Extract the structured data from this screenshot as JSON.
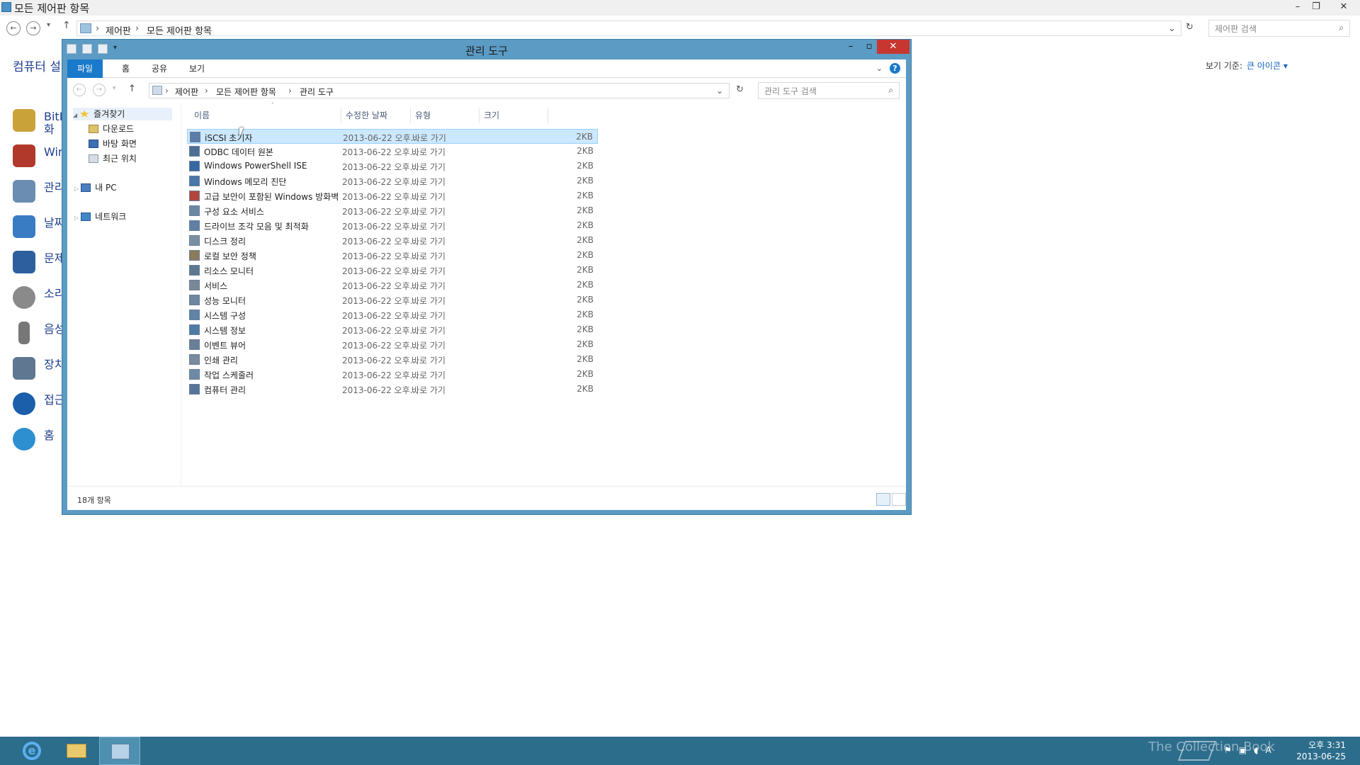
{
  "background_window": {
    "title": "모든 제어판 항목",
    "breadcrumb": [
      "제어판",
      "모든 제어판 항목"
    ],
    "search_placeholder": "제어판 검색",
    "heading": "컴퓨터 설",
    "view_by_label": "보기 기준:",
    "view_by_value": "큰 아이콘 ▾",
    "items": [
      {
        "label": "BitL\n화",
        "color": "#c9a33a"
      },
      {
        "label": "Win",
        "color": "#b0392b"
      },
      {
        "label": "관리",
        "color": "#6b8db2"
      },
      {
        "label": "날짜",
        "color": "#3a7cc4"
      },
      {
        "label": "문제",
        "color": "#2d5f9e"
      },
      {
        "label": "소리",
        "color": "#8a8a8a"
      },
      {
        "label": "음성",
        "color": "#777777"
      },
      {
        "label": "장치",
        "color": "#5f7790"
      },
      {
        "label": "접근",
        "color": "#1b5faa"
      },
      {
        "label": "홈",
        "color": "#2d8fd0"
      }
    ]
  },
  "window": {
    "title": "관리 도구",
    "ribbon_tabs": [
      {
        "label": "파일",
        "active": true
      },
      {
        "label": "홈",
        "active": false
      },
      {
        "label": "공유",
        "active": false
      },
      {
        "label": "보기",
        "active": false
      }
    ],
    "breadcrumb": [
      "제어판",
      "모든 제어판 항목",
      "관리 도구"
    ],
    "search_placeholder": "관리 도구 검색",
    "nav_tree": [
      {
        "label": "즐겨찾기",
        "level": 0,
        "selected": true
      },
      {
        "label": "다운로드",
        "level": 1
      },
      {
        "label": "바탕 화면",
        "level": 1
      },
      {
        "label": "최근 위치",
        "level": 1
      },
      {
        "label": "내 PC",
        "level": 0
      },
      {
        "label": "네트워크",
        "level": 0
      }
    ],
    "columns": [
      "이름",
      "수정한 날짜",
      "유형",
      "크기"
    ],
    "files": [
      {
        "name": "iSCSI 초기자",
        "date": "2013-06-22 오후...",
        "type": "바로 가기",
        "size": "2KB",
        "selected": true
      },
      {
        "name": "ODBC 데이터 원본",
        "date": "2013-06-22 오후...",
        "type": "바로 가기",
        "size": "2KB"
      },
      {
        "name": "Windows PowerShell ISE",
        "date": "2013-06-22 오후...",
        "type": "바로 가기",
        "size": "2KB"
      },
      {
        "name": "Windows 메모리 진단",
        "date": "2013-06-22 오후...",
        "type": "바로 가기",
        "size": "2KB"
      },
      {
        "name": "고급 보안이 포함된 Windows 방화벽",
        "date": "2013-06-22 오후...",
        "type": "바로 가기",
        "size": "2KB"
      },
      {
        "name": "구성 요소 서비스",
        "date": "2013-06-22 오후...",
        "type": "바로 가기",
        "size": "2KB"
      },
      {
        "name": "드라이브 조각 모음 및 최적화",
        "date": "2013-06-22 오후...",
        "type": "바로 가기",
        "size": "2KB"
      },
      {
        "name": "디스크 정리",
        "date": "2013-06-22 오후...",
        "type": "바로 가기",
        "size": "2KB"
      },
      {
        "name": "로컬 보안 정책",
        "date": "2013-06-22 오후...",
        "type": "바로 가기",
        "size": "2KB"
      },
      {
        "name": "리소스 모니터",
        "date": "2013-06-22 오후...",
        "type": "바로 가기",
        "size": "2KB"
      },
      {
        "name": "서비스",
        "date": "2013-06-22 오후...",
        "type": "바로 가기",
        "size": "2KB"
      },
      {
        "name": "성능 모니터",
        "date": "2013-06-22 오후...",
        "type": "바로 가기",
        "size": "2KB"
      },
      {
        "name": "시스템 구성",
        "date": "2013-06-22 오후...",
        "type": "바로 가기",
        "size": "2KB"
      },
      {
        "name": "시스템 정보",
        "date": "2013-06-22 오후...",
        "type": "바로 가기",
        "size": "2KB"
      },
      {
        "name": "이벤트 뷰어",
        "date": "2013-06-22 오후...",
        "type": "바로 가기",
        "size": "2KB"
      },
      {
        "name": "인쇄 관리",
        "date": "2013-06-22 오후...",
        "type": "바로 가기",
        "size": "2KB"
      },
      {
        "name": "작업 스케줄러",
        "date": "2013-06-22 오후...",
        "type": "바로 가기",
        "size": "2KB"
      },
      {
        "name": "컴퓨터 관리",
        "date": "2013-06-22 오후...",
        "type": "바로 가기",
        "size": "2KB"
      }
    ],
    "status_text": "18개 항목"
  },
  "taskbar": {
    "time": "오후 3:31",
    "date": "2013-06-25",
    "watermark": "The Collection Book",
    "ime": "A",
    "colors": {
      "bar": "#2d6d8c",
      "accent": "#1979ca"
    }
  }
}
